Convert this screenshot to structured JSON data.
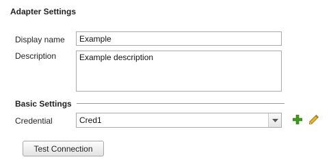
{
  "panel": {
    "title": "Adapter Settings"
  },
  "fields": {
    "display_name": {
      "label": "Display name",
      "value": "Example"
    },
    "description": {
      "label": "Description",
      "value": "Example description"
    }
  },
  "basic_settings": {
    "heading": "Basic Settings",
    "credential": {
      "label": "Credential",
      "selected": "Cred1"
    },
    "add_icon": "plus-icon",
    "edit_icon": "pencil-icon",
    "colors": {
      "add_green": "#3f9a1c",
      "pencil_yellow": "#e9b526"
    }
  },
  "actions": {
    "test_connection_label": "Test Connection"
  }
}
